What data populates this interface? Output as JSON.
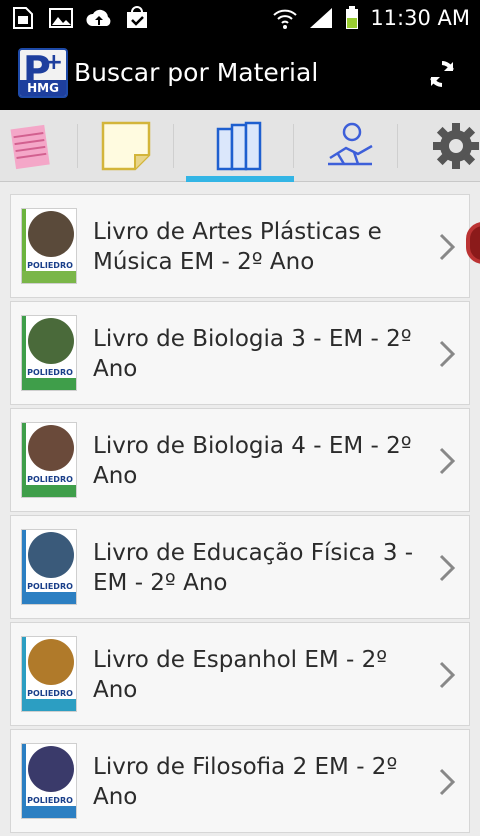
{
  "status_bar": {
    "time": "11:30 AM",
    "icons": [
      "sim-icon",
      "image-icon",
      "cloud-upload-icon",
      "shopping-bag-check-icon",
      "wifi-icon",
      "signal-icon",
      "battery-icon"
    ]
  },
  "app_bar": {
    "logo_letter": "P",
    "logo_plus": "+",
    "logo_text": "HMG",
    "title": "Buscar por Material",
    "refresh_icon": "refresh-icon"
  },
  "tabs": [
    {
      "name": "notes-tab",
      "icon": "notepad-icon",
      "active": false
    },
    {
      "name": "sticky-note-tab",
      "icon": "sticky-note-icon",
      "active": false
    },
    {
      "name": "books-tab",
      "icon": "books-icon",
      "active": true
    },
    {
      "name": "reading-tab",
      "icon": "reader-icon",
      "active": false
    },
    {
      "name": "settings-tab",
      "icon": "gear-icon",
      "active": false
    }
  ],
  "colors": {
    "accent": "#33b5e5",
    "statusbar": "#000000",
    "list_bg": "#f7f7f7",
    "text": "#2b2b2b"
  },
  "materials": [
    {
      "title": "Livro de Artes Plásticas e Música EM - 2º Ano",
      "brand": "POLIEDRO",
      "art_color": "#5a4a3a",
      "band_color": "#6cb33e",
      "foot_color": "#7ab648"
    },
    {
      "title": "Livro de Biologia 3 - EM - 2º Ano",
      "brand": "POLIEDRO",
      "art_color": "#4a6a3a",
      "band_color": "#3f9e4a",
      "foot_color": "#3f9e4a"
    },
    {
      "title": "Livro de Biologia 4 - EM - 2º Ano",
      "brand": "POLIEDRO",
      "art_color": "#6a4a3a",
      "band_color": "#3f9e4a",
      "foot_color": "#3f9e4a"
    },
    {
      "title": "Livro de Educação Física 3 - EM - 2º Ano",
      "brand": "POLIEDRO",
      "art_color": "#3a5a7a",
      "band_color": "#2c7fc2",
      "foot_color": "#2c7fc2"
    },
    {
      "title": "Livro de Espanhol EM - 2º Ano",
      "brand": "POLIEDRO",
      "art_color": "#b07a2a",
      "band_color": "#2c9ec2",
      "foot_color": "#2c9ec2"
    },
    {
      "title": "Livro de Filosofia 2 EM - 2º Ano",
      "brand": "POLIEDRO",
      "art_color": "#3a3a6a",
      "band_color": "#2c7fc2",
      "foot_color": "#2c7fc2"
    }
  ]
}
